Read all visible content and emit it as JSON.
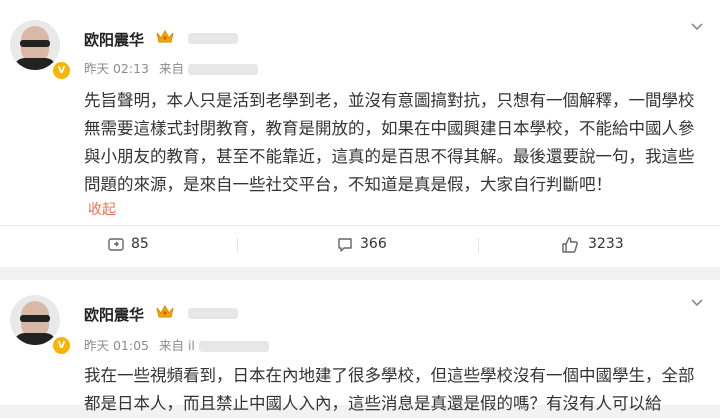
{
  "posts": [
    {
      "username": "欧阳震华",
      "time": "昨天 02:13",
      "source_label": "来自",
      "content": "先旨聲明，本人只是活到老學到老，並沒有意圖搞對抗，只想有一個解釋，一間學校無需要這樣式封閉教育，教育是開放的，如果在中國興建日本學校，不能給中國人參與小朋友的教育，甚至不能靠近，這真的是百思不得其解。最後還要說一句，我這些問題的來源，是來自一些社交平台，不知道是真是假，大家自行判斷吧！",
      "collapse_label": "收起",
      "actions": {
        "repost": "85",
        "comment": "366",
        "like": "3233"
      }
    },
    {
      "username": "欧阳震华",
      "time": "昨天 01:05",
      "source_label": "来自 il",
      "content": "我在一些視頻看到，日本在內地建了很多學校，但這些學校沒有一個中國學生，全部都是日本人，而且禁止中國人入內，這些消息是真還是假的嗎？有沒有人可以給"
    }
  ],
  "icons": {
    "verified": "verified-badge-icon",
    "crown": "crown-icon",
    "more": "chevron-down-icon",
    "repost": "repost-icon",
    "comment": "comment-icon",
    "like": "thumbs-up-icon"
  },
  "colors": {
    "collapse": "#eb7350",
    "badge": "#f7b500",
    "text": "#333333",
    "meta": "#8c8c8c"
  }
}
